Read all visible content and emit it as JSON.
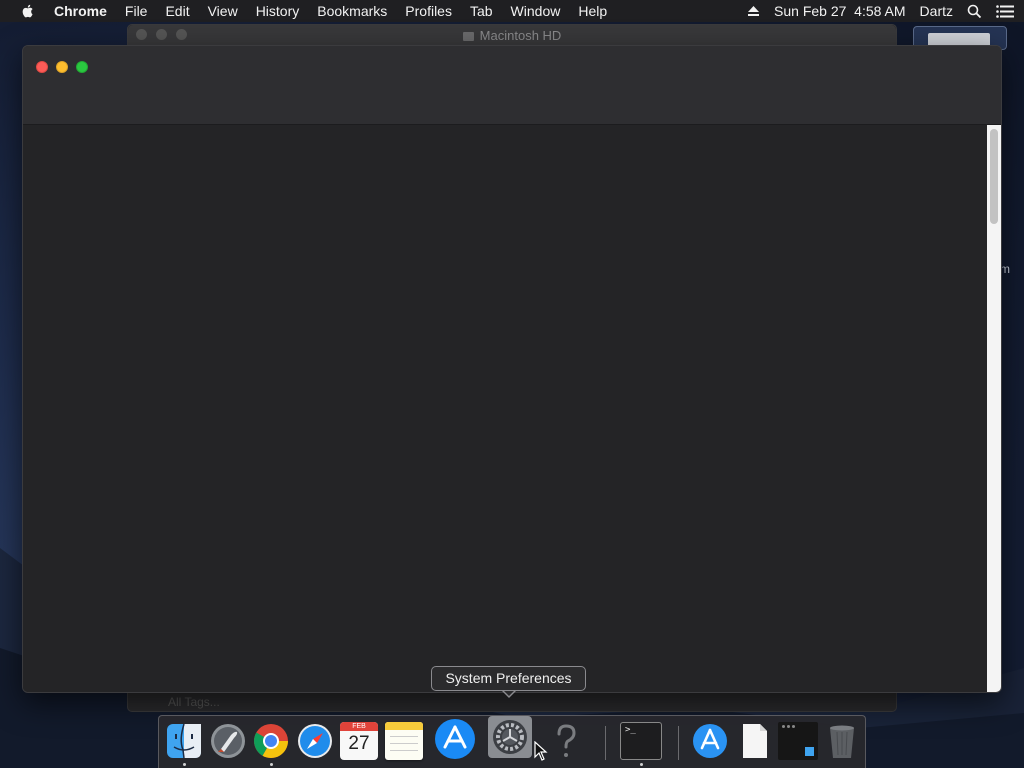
{
  "menubar": {
    "app_name": "Chrome",
    "menus": [
      "File",
      "Edit",
      "View",
      "History",
      "Bookmarks",
      "Profiles",
      "Tab",
      "Window",
      "Help"
    ],
    "datetime": "Sun Feb 27  4:58 AM",
    "user": "Dartz",
    "icons": [
      "apple-icon",
      "eject-icon",
      "spotlight-search-icon",
      "notification-center-icon"
    ]
  },
  "background_window": {
    "title": "Macintosh HD",
    "sidebar_fragment": "All Tags..."
  },
  "desktop": {
    "side_label": "m"
  },
  "main_window": {
    "app": "Chrome"
  },
  "tooltip": {
    "text": "System Preferences"
  },
  "dock": {
    "items": [
      {
        "name": "Finder",
        "icon": "finder-icon",
        "running": true
      },
      {
        "name": "Launchpad",
        "icon": "launchpad-icon",
        "running": false
      },
      {
        "name": "Google Chrome",
        "icon": "chrome-icon",
        "running": true
      },
      {
        "name": "Safari",
        "icon": "safari-icon",
        "running": false
      },
      {
        "name": "Calendar",
        "icon": "calendar-icon",
        "running": false,
        "month": "FEB",
        "day": "27"
      },
      {
        "name": "Notes",
        "icon": "notes-icon",
        "running": false
      },
      {
        "name": "App Store",
        "icon": "app-store-icon",
        "running": false
      },
      {
        "name": "System Preferences",
        "icon": "system-preferences-icon",
        "running": false
      },
      {
        "name": "Unknown App",
        "icon": "question-mark-icon",
        "running": false
      },
      {
        "name": "Terminal",
        "icon": "terminal-icon",
        "running": true
      },
      {
        "name": "Applications",
        "icon": "applications-folder-icon",
        "running": false
      },
      {
        "name": "Document",
        "icon": "document-icon",
        "running": false
      },
      {
        "name": "Screenshot",
        "icon": "screenshot-icon",
        "running": false
      },
      {
        "name": "Trash",
        "icon": "trash-icon",
        "running": false
      }
    ],
    "terminal_prompt": ">_"
  },
  "colors": {
    "close": "#fc5b57",
    "minimize": "#fdbd2e",
    "maximize": "#2ac840",
    "window_bg": "#242426",
    "menubar_bg": "#1f1f22"
  }
}
